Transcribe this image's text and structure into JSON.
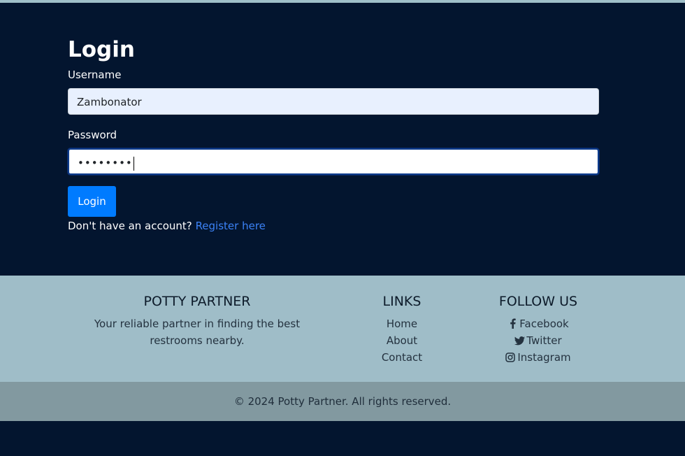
{
  "login": {
    "title": "Login",
    "username_label": "Username",
    "username_value": "Zambonator",
    "password_label": "Password",
    "password_masked": "••••••••",
    "button_label": "Login",
    "register_prompt": "Don't have an account?",
    "register_link": "Register here"
  },
  "footer": {
    "brand": {
      "title": "POTTY PARTNER",
      "description": "Your reliable partner in finding the best restrooms nearby."
    },
    "links": {
      "title": "LINKS",
      "items": [
        "Home",
        "About",
        "Contact"
      ]
    },
    "follow": {
      "title": "FOLLOW US",
      "items": [
        {
          "label": "Facebook",
          "icon": "facebook-icon"
        },
        {
          "label": "Twitter",
          "icon": "twitter-icon"
        },
        {
          "label": "Instagram",
          "icon": "instagram-icon"
        }
      ]
    },
    "copyright": "© 2024 Potty Partner. All rights reserved."
  },
  "colors": {
    "page_bg": "#03152f",
    "footer_bg": "#9fbdc8",
    "copyright_bg": "#8299a0",
    "button": "#007bff",
    "link": "#3b82f6"
  }
}
